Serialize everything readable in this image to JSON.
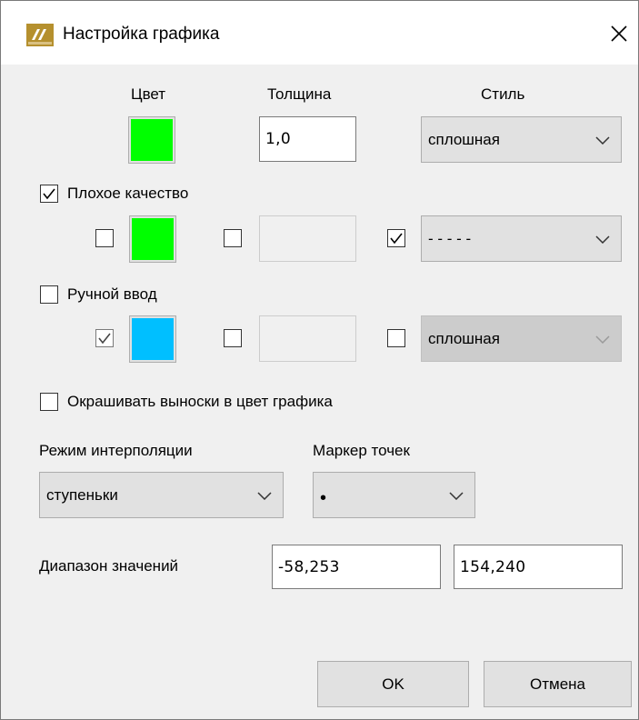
{
  "window": {
    "title": "Настройка графика",
    "app_icon": "trends-app-icon",
    "close_icon": "close-icon"
  },
  "line_settings": {
    "color_label": "Цвет",
    "thickness_label": "Толщина",
    "style_label": "Стиль",
    "color": "#00ff00",
    "thickness_value": "1,0",
    "style_value": "сплошная"
  },
  "bad_quality": {
    "label": "Плохое качество",
    "checked": true,
    "color_checked": false,
    "color": "#00ff00",
    "thickness_checked": false,
    "thickness_value": "",
    "style_checked": true,
    "style_value": "- - - - -"
  },
  "manual_input": {
    "label": "Ручной ввод",
    "checked": false,
    "color_checked": true,
    "color": "#00bfff",
    "thickness_checked": false,
    "thickness_value": "",
    "style_checked": false,
    "style_value": "сплошная"
  },
  "color_callouts": {
    "label": "Окрашивать выноски в цвет графика",
    "checked": false
  },
  "interpolation": {
    "label": "Режим интерполяции",
    "value": "ступеньки"
  },
  "point_marker": {
    "label": "Маркер точек",
    "value": "•"
  },
  "value_range": {
    "label": "Диапазон значений",
    "min": "-58,253",
    "max": "154,240"
  },
  "buttons": {
    "ok": "OK",
    "cancel": "Отмена"
  }
}
